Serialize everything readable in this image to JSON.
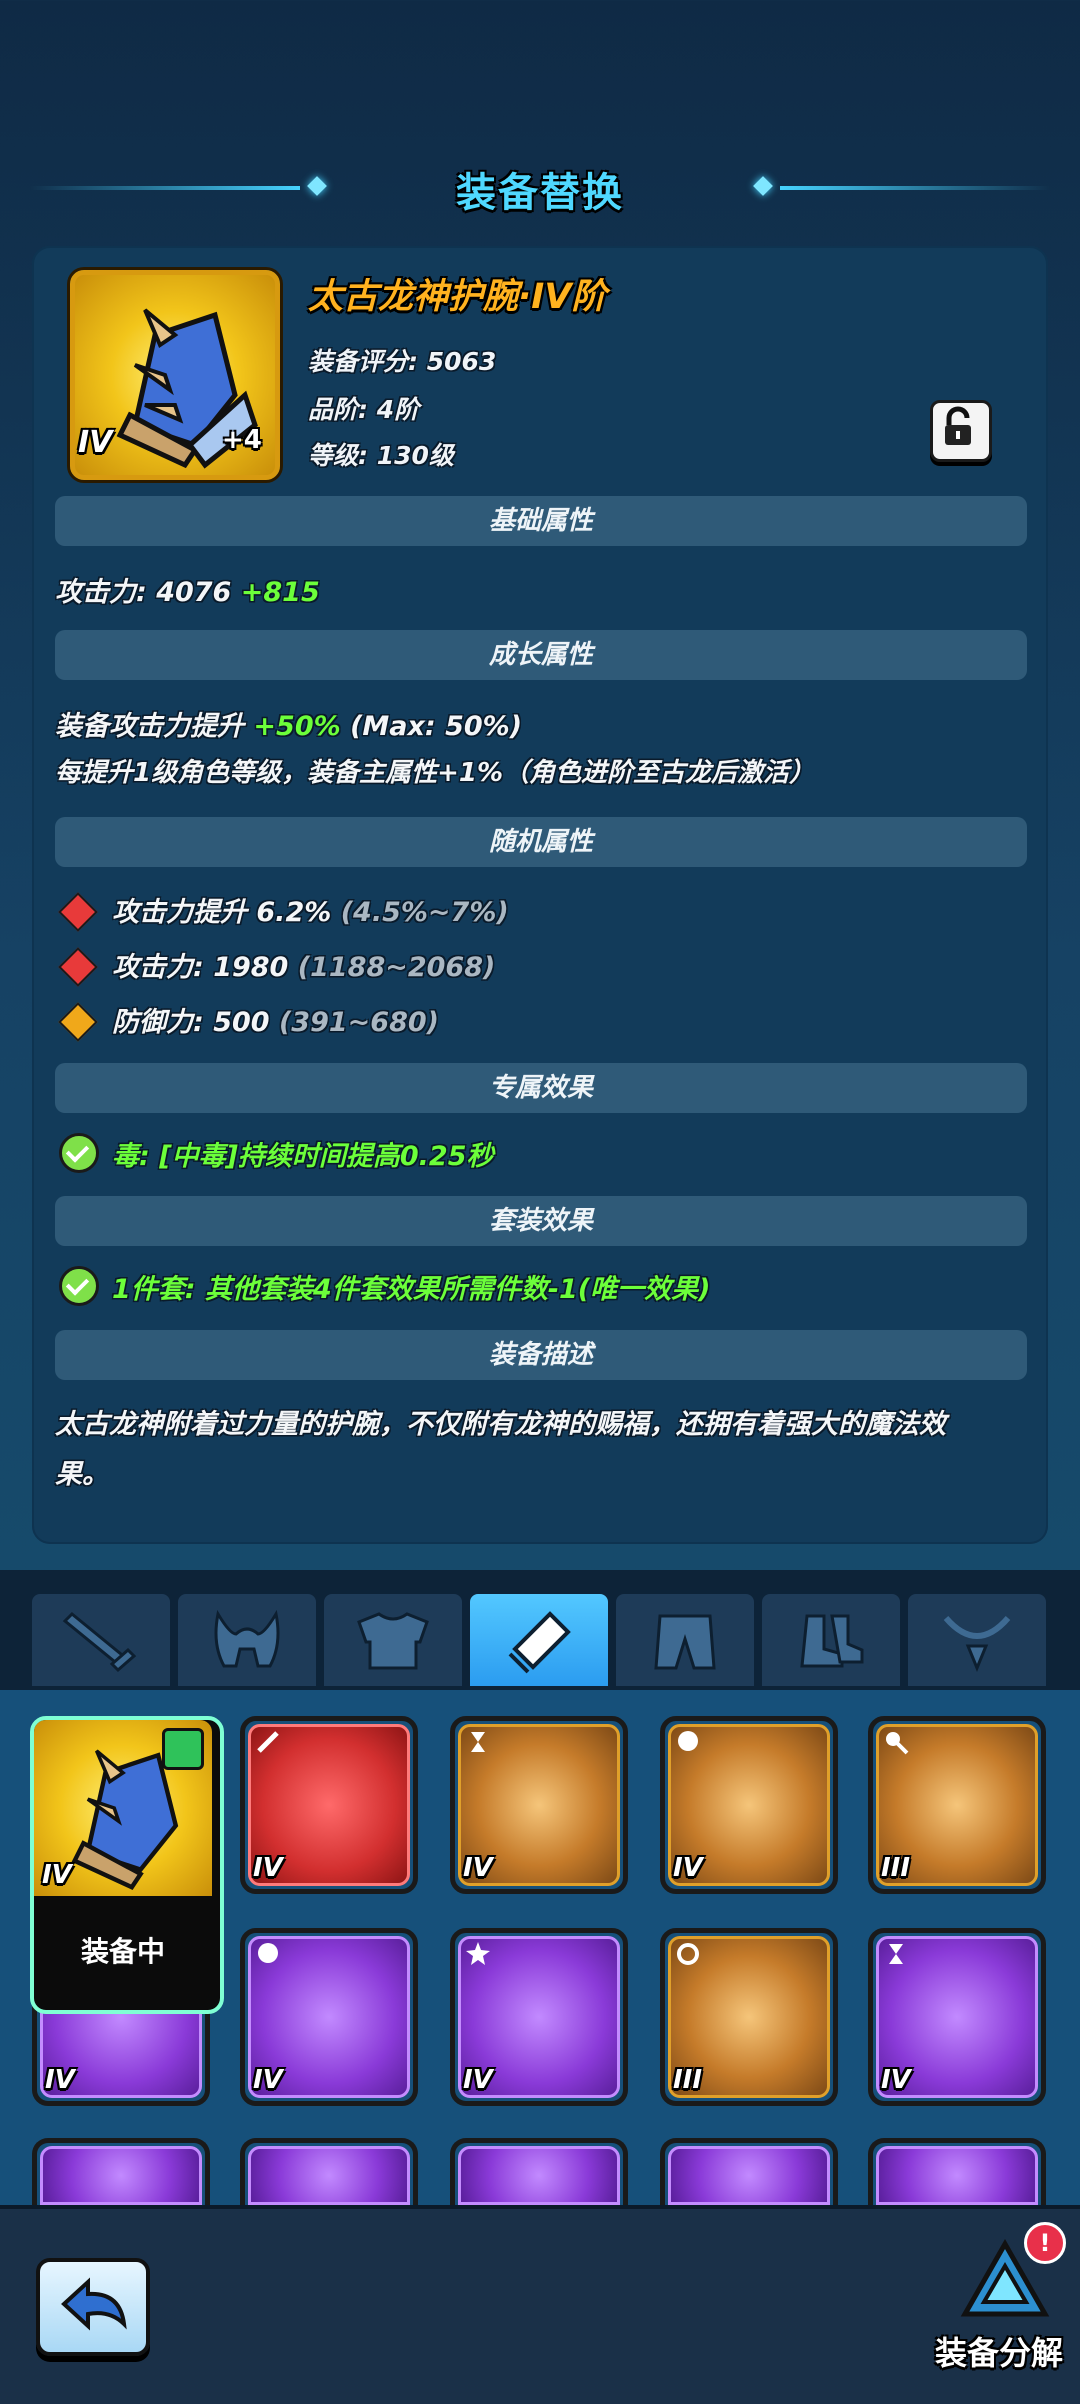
{
  "header": {
    "title": "装备替换"
  },
  "item": {
    "name": "太古龙神护腕·IV阶",
    "score": "装备评分: 5063",
    "grade": "品阶: 4阶",
    "level": "等级: 130级",
    "tier": "IV",
    "plus": "+4"
  },
  "sections": {
    "basic": "基础属性",
    "growth": "成长属性",
    "random": "随机属性",
    "exclusive": "专属效果",
    "set": "套装效果",
    "desc": "装备描述"
  },
  "basic": {
    "label": "攻击力: 4076",
    "bonus": "+815"
  },
  "growth": {
    "line1_label": "装备攻击力提升",
    "line1_green": "+50%",
    "line1_max": "(Max: 50%)",
    "line2": "每提升1级角色等级，装备主属性+1%（角色进阶至古龙后激活）"
  },
  "random": [
    {
      "label": "攻击力提升 6.2%",
      "range": "(4.5%~7%)",
      "gem_color": "#e83a3a"
    },
    {
      "label": "攻击力: 1980",
      "range": "(1188~2068)",
      "gem_color": "#e83a3a"
    },
    {
      "label": "防御力: 500",
      "range": "(391~680)",
      "gem_color": "#f0a81a"
    }
  ],
  "exclusive": {
    "text": "毒: [中毒]持续时间提高0.25秒"
  },
  "set": {
    "text": "1件套: 其他套装4件套效果所需件数-1(唯一效果)"
  },
  "description": {
    "line1": "太古龙神附着过力量的护腕，不仅附有龙神的赐福，还拥有着强大的魔法效",
    "line2": "果。"
  },
  "tabs": [
    "sword-icon",
    "helmet-icon",
    "armor-icon",
    "bracer-icon",
    "pants-icon",
    "boots-icon",
    "necklace-icon"
  ],
  "selected_tab": 3,
  "grid": {
    "equipped_label": "装备中",
    "row1": [
      {
        "tier": "IV",
        "color": "yellow"
      },
      {
        "tier": "IV",
        "color": "red"
      },
      {
        "tier": "IV",
        "color": "gold"
      },
      {
        "tier": "IV",
        "color": "gold"
      },
      {
        "tier": "III",
        "color": "gold"
      }
    ],
    "row2": [
      {
        "tier": "IV",
        "color": "purple"
      },
      {
        "tier": "IV",
        "color": "purple"
      },
      {
        "tier": "IV",
        "color": "purple"
      },
      {
        "tier": "III",
        "color": "gold"
      },
      {
        "tier": "IV",
        "color": "purple"
      }
    ]
  },
  "bottom": {
    "dismantle_label": "装备分解",
    "notice": "!"
  }
}
